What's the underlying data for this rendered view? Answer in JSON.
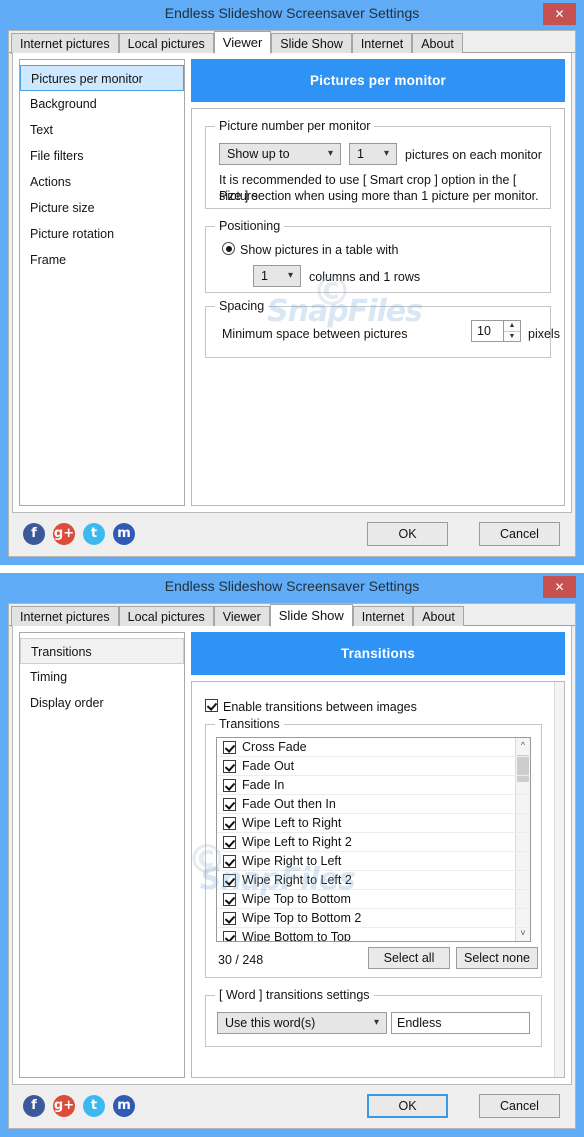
{
  "window1": {
    "title": "Endless Slideshow Screensaver Settings",
    "close_label": "✕",
    "tabs": [
      {
        "label": "Internet pictures",
        "active": false
      },
      {
        "label": "Local pictures",
        "active": false
      },
      {
        "label": "Viewer",
        "active": true
      },
      {
        "label": "Slide Show",
        "active": false
      },
      {
        "label": "Internet",
        "active": false
      },
      {
        "label": "About",
        "active": false
      }
    ],
    "sidebar": [
      {
        "label": "Pictures per monitor",
        "selected": true
      },
      {
        "label": "Background",
        "selected": false
      },
      {
        "label": "Text",
        "selected": false
      },
      {
        "label": "File filters",
        "selected": false
      },
      {
        "label": "Actions",
        "selected": false
      },
      {
        "label": "Picture size",
        "selected": false
      },
      {
        "label": "Picture rotation",
        "selected": false
      },
      {
        "label": "Frame",
        "selected": false
      }
    ],
    "panel_header": "Pictures per monitor",
    "group_number": {
      "title": "Picture number per monitor",
      "mode_value": "Show up to",
      "count_value": "1",
      "suffix": "pictures on each monitor",
      "hint_line1": "It is recommended to use [ Smart crop ] option in the [ Picture",
      "hint_line2": "size ] section when using more than 1 picture per monitor."
    },
    "group_positioning": {
      "title": "Positioning",
      "radio_label": "Show pictures in a table with",
      "columns_value": "1",
      "columns_suffix": "columns and 1 rows"
    },
    "group_spacing": {
      "title": "Spacing",
      "label": "Minimum space between pictures",
      "value": "10",
      "unit": "pixels"
    },
    "footer": {
      "facebook": "f",
      "googleplus": "g+",
      "twitter": "t",
      "myspace": "m",
      "ok": "OK",
      "cancel": "Cancel"
    }
  },
  "window2": {
    "title": "Endless Slideshow Screensaver Settings",
    "close_label": "✕",
    "tabs": [
      {
        "label": "Internet pictures",
        "active": false
      },
      {
        "label": "Local pictures",
        "active": false
      },
      {
        "label": "Viewer",
        "active": false
      },
      {
        "label": "Slide Show",
        "active": true
      },
      {
        "label": "Internet",
        "active": false
      },
      {
        "label": "About",
        "active": false
      }
    ],
    "sidebar": [
      {
        "label": "Transitions",
        "selected": true
      },
      {
        "label": "Timing",
        "selected": false
      },
      {
        "label": "Display order",
        "selected": false
      }
    ],
    "panel_header": "Transitions",
    "enable_label": "Enable transitions between images",
    "group_transitions": {
      "title": "Transitions",
      "items": [
        {
          "label": "Cross Fade",
          "checked": true
        },
        {
          "label": "Fade Out",
          "checked": true
        },
        {
          "label": "Fade In",
          "checked": true
        },
        {
          "label": "Fade Out then In",
          "checked": true
        },
        {
          "label": "Wipe Left to Right",
          "checked": true
        },
        {
          "label": "Wipe Left to Right 2",
          "checked": true
        },
        {
          "label": "Wipe Right to Left",
          "checked": true
        },
        {
          "label": "Wipe Right to Left 2",
          "checked": true
        },
        {
          "label": "Wipe Top to Bottom",
          "checked": true
        },
        {
          "label": "Wipe Top to Bottom 2",
          "checked": true
        },
        {
          "label": "Wipe Bottom to Top",
          "checked": true
        }
      ],
      "count": "30 / 248",
      "select_all": "Select all",
      "select_none": "Select none"
    },
    "group_word": {
      "title": "[ Word ] transitions settings",
      "mode_value": "Use this word(s)",
      "word_value": "Endless"
    },
    "footer": {
      "facebook": "f",
      "googleplus": "g+",
      "twitter": "t",
      "myspace": "m",
      "ok": "OK",
      "cancel": "Cancel"
    }
  },
  "watermark": {
    "text": "SnapFiles",
    "copyright": "©"
  }
}
